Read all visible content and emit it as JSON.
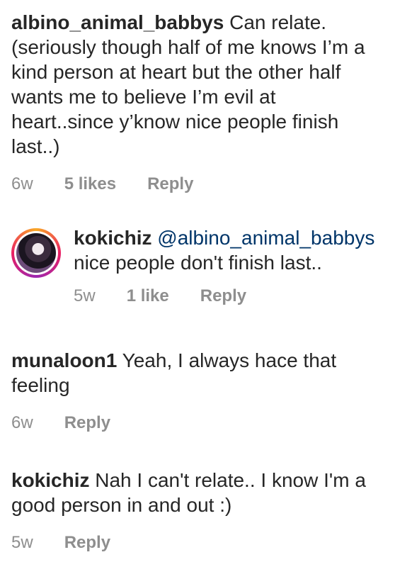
{
  "comments": [
    {
      "username": "albino_animal_babbys",
      "text": "Can relate. (seriously though half of me knows I’m a kind person at heart but the other half wants me to believe I’m evil at heart..since y’know nice people finish last..)",
      "time": "6w",
      "likes": "5 likes",
      "reply": "Reply"
    },
    {
      "username": "kokichiz",
      "mention": "@albino_animal_babbys",
      "text": "nice people don't finish last..",
      "time": "5w",
      "likes": "1 like",
      "reply": "Reply",
      "is_reply": true
    },
    {
      "username": "munaloon1",
      "text": "Yeah, I always hace that feeling",
      "time": "6w",
      "reply": "Reply"
    },
    {
      "username": "kokichiz",
      "text": "Nah I can't relate.. I know I'm a good person in and out :)",
      "time": "5w",
      "reply": "Reply"
    }
  ],
  "colors": {
    "text": "#262626",
    "muted": "#8e8e8e",
    "mention": "#003569"
  }
}
